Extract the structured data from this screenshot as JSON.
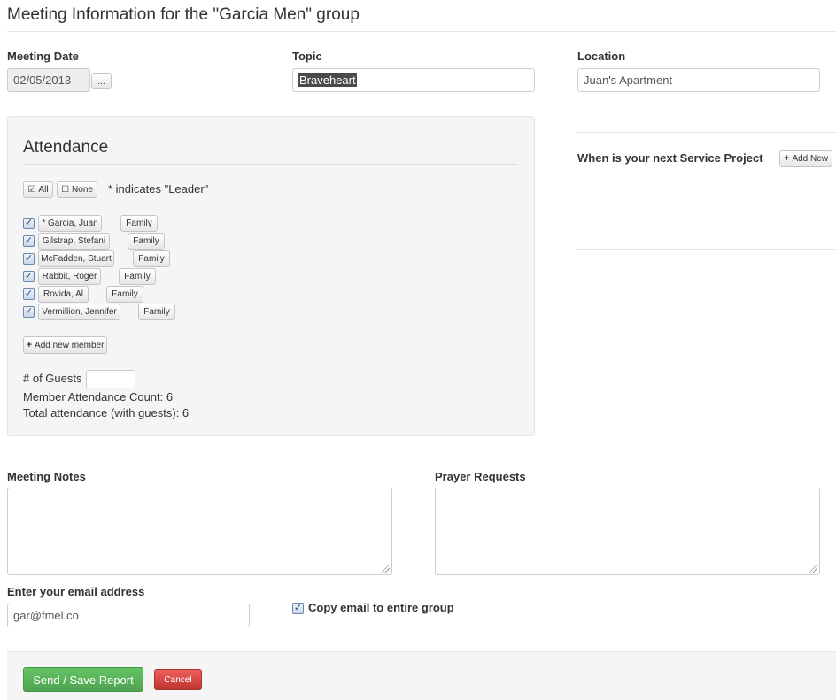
{
  "page_title": "Meeting Information for the \"Garcia Men\" group",
  "meeting_date": {
    "label": "Meeting Date",
    "value": "02/05/2013",
    "picker_label": "..."
  },
  "topic": {
    "label": "Topic",
    "value": "Braveheart"
  },
  "location": {
    "label": "Location",
    "value": "Juan's Apartment"
  },
  "attendance": {
    "title": "Attendance",
    "all_label": "All",
    "none_label": "None",
    "leader_note": "* indicates \"Leader\"",
    "family_label": "Family",
    "members": [
      {
        "name": "* Garcia, Juan",
        "checked": true
      },
      {
        "name": "Gilstrap, Stefani",
        "checked": true
      },
      {
        "name": "McFadden, Stuart",
        "checked": true
      },
      {
        "name": "Rabbit, Roger",
        "checked": true
      },
      {
        "name": "Rovida, Al",
        "checked": true
      },
      {
        "name": "Vermillion, Jennifer",
        "checked": true
      }
    ],
    "add_member_label": "Add new member",
    "guests_label": "# of Guests",
    "guests_value": "",
    "member_count_text": "Member Attendance Count: 6",
    "total_text": "Total attendance (with guests): 6"
  },
  "service_project": {
    "label": "When is your next Service Project",
    "add_label": "Add New"
  },
  "meeting_notes": {
    "label": "Meeting Notes",
    "value": ""
  },
  "prayer_requests": {
    "label": "Prayer Requests",
    "value": ""
  },
  "email": {
    "label": "Enter your email address",
    "value": "gar@fmel.co"
  },
  "copy_email": {
    "label": "Copy email to entire group",
    "checked": true
  },
  "actions": {
    "send_label": "Send / Save Report",
    "cancel_label": "Cancel"
  },
  "icons": {
    "checkbox": "checkmark-icon",
    "add": "plus-icon",
    "check_all": "checked-box-icon",
    "check_none": "empty-box-icon"
  }
}
